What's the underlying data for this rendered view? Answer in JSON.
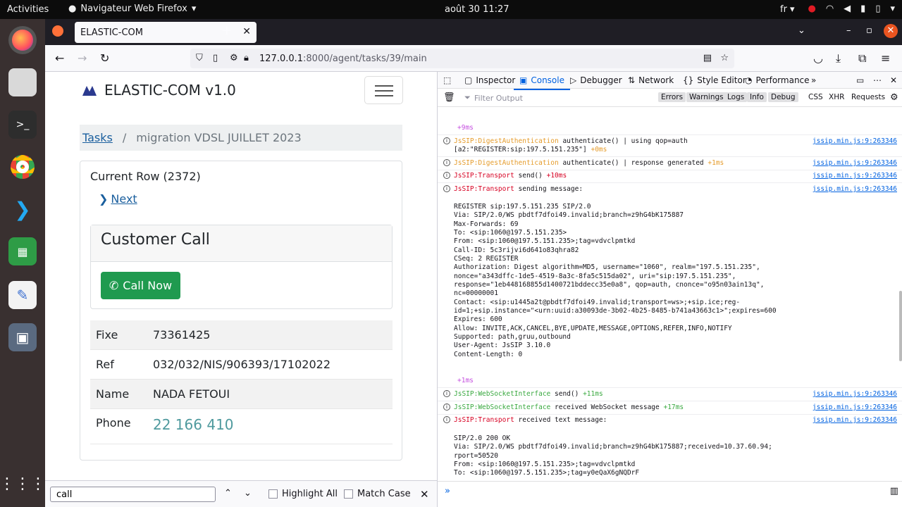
{
  "system": {
    "activities": "Activities",
    "app_name": "Navigateur Web Firefox",
    "clock": "août 30  11:27",
    "language": "fr"
  },
  "browser": {
    "tab_title": "ELASTIC-COM",
    "url_host": "127.0.0.1",
    "url_path": ":8000/agent/tasks/39/main"
  },
  "page": {
    "brand": "ELASTIC-COM v1.0",
    "breadcrumb": {
      "link": "Tasks",
      "separator": "/",
      "current": "migration VDSL JUILLET 2023"
    },
    "current_row": "Current Row (2372)",
    "next_label": "Next",
    "customer_call_title": "Customer Call",
    "call_button": "Call Now",
    "rows": [
      {
        "key": "Fixe",
        "value": "73361425"
      },
      {
        "key": "Ref",
        "value": "032/032/NIS/906393/17102022"
      },
      {
        "key": "Name",
        "value": "NADA FETOUI"
      },
      {
        "key": "Phone",
        "value": "22 166 410"
      }
    ]
  },
  "findbar": {
    "query": "call",
    "highlight_all": "Highlight All",
    "match_case": "Match Case"
  },
  "devtools": {
    "tabs": [
      "Inspector",
      "Console",
      "Debugger",
      "Network",
      "Style Editor",
      "Performance"
    ],
    "filter_placeholder": "Filter Output",
    "filters": [
      "Errors",
      "Warnings",
      "Logs",
      "Info",
      "Debug",
      "CSS",
      "XHR",
      "Requests"
    ],
    "source": "jssip.min.js:9:263346",
    "log": {
      "t0": "+9ms",
      "l1_tag": "JsSIP:DigestAuthentication",
      "l1_msg": "authenticate() | using qop=auth",
      "l1_msg2": "[a2:\"REGISTER:sip:197.5.151.235\"]",
      "l1_t": "+0ms",
      "l2_tag": "JsSIP:DigestAuthentication",
      "l2_msg": "authenticate() | response generated",
      "l2_t": "+1ms",
      "l3_tag": "JsSIP:Transport",
      "l3_msg": "send()",
      "l3_t": "+10ms",
      "l4_tag": "JsSIP:Transport",
      "l4_msg": "sending message:",
      "req": [
        "REGISTER sip:197.5.151.235 SIP/2.0",
        "Via: SIP/2.0/WS pbdtf7dfoi49.invalid;branch=z9hG4bK175887",
        "Max-Forwards: 69",
        "To: <sip:1060@197.5.151.235>",
        "From: <sip:1060@197.5.151.235>;tag=vdvclpmtkd",
        "Call-ID: 5c3rijvi6d641o83qhra82",
        "CSeq: 2 REGISTER",
        "Authorization: Digest algorithm=MD5, username=\"1060\", realm=\"197.5.151.235\",",
        "nonce=\"a343dffc-1de5-4519-8a3c-8fa5c515da02\", uri=\"sip:197.5.151.235\",",
        "response=\"1eb448168855d1400721bddecc35e0a8\", qop=auth, cnonce=\"o95n03ain13q\",",
        "nc=00000001",
        "Contact: <sip:u1445a2t@pbdtf7dfoi49.invalid;transport=ws>;+sip.ice;reg-",
        "id=1;+sip.instance=\"<urn:uuid:a30093de-3b02-4b25-8485-b741a43663c1>\";expires=600",
        "Expires: 600",
        "Allow: INVITE,ACK,CANCEL,BYE,UPDATE,MESSAGE,OPTIONS,REFER,INFO,NOTIFY",
        "Supported: path,gruu,outbound",
        "User-Agent: JsSIP 3.10.0",
        "Content-Length: 0"
      ],
      "t1": "+1ms",
      "l5_tag": "JsSIP:WebSocketInterface",
      "l5_msg": "send()",
      "l5_t": "+11ms",
      "l6_tag": "JsSIP:WebSocketInterface",
      "l6_msg": "received WebSocket message",
      "l6_t": "+17ms",
      "l7_tag": "JsSIP:Transport",
      "l7_msg": "received text message:",
      "resp": [
        "SIP/2.0 200 OK",
        "Via: SIP/2.0/WS pbdtf7dfoi49.invalid;branch=z9hG4bK175887;received=10.37.60.94;",
        "rport=50520",
        "From: <sip:1060@197.5.151.235>;tag=vdvclpmtkd",
        "To: <sip:1060@197.5.151.235>;tag=y0eQaX6gNQDrF"
      ]
    }
  }
}
